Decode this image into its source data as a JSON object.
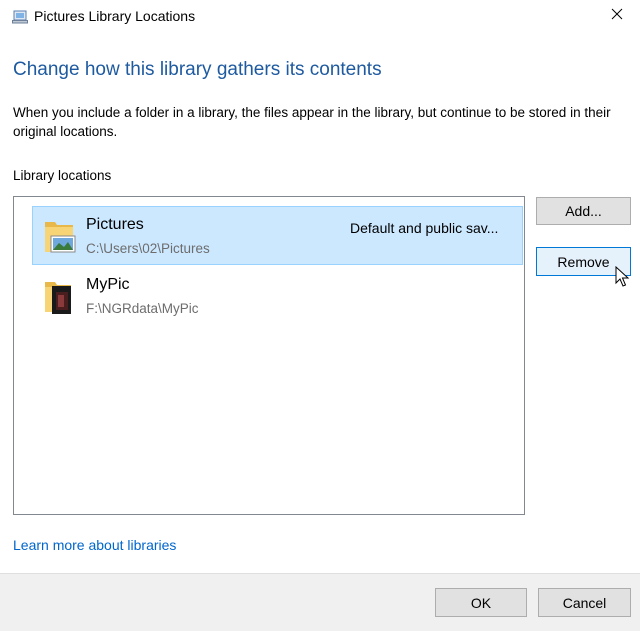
{
  "window": {
    "title": "Pictures Library Locations",
    "icon": "library-icon",
    "close_glyph": "✕"
  },
  "main": {
    "heading": "Change how this library gathers its contents",
    "description": "When you include a folder in a library, the files appear in the library, but continue to be stored in their original locations.",
    "locations_label": "Library locations"
  },
  "locations": [
    {
      "name": "Pictures",
      "path": "C:\\Users\\02\\Pictures",
      "note": "Default and public sav...",
      "selected": true,
      "icon": "pictures-folder-icon"
    },
    {
      "name": "MyPic",
      "path": "F:\\NGRdata\\MyPic",
      "note": "",
      "selected": false,
      "icon": "folder-icon"
    }
  ],
  "buttons": {
    "add": "Add...",
    "remove": "Remove",
    "ok": "OK",
    "cancel": "Cancel"
  },
  "link": {
    "learn_more": "Learn more about libraries"
  },
  "colors": {
    "heading": "#1e5aa0",
    "link": "#0066cc",
    "selection_bg": "#cce8ff",
    "selection_border": "#99d1ff",
    "focus_border": "#0078d7"
  }
}
